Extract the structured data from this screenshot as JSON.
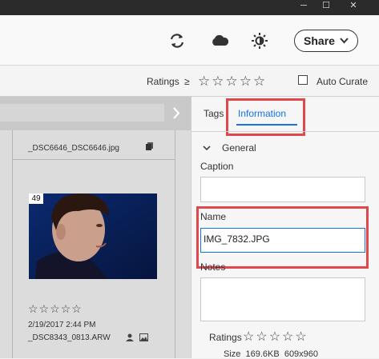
{
  "titlebar": {
    "minimize": "─",
    "maximize": "☐",
    "close": "✕"
  },
  "toolbar": {
    "share_label": "Share"
  },
  "filter": {
    "ratings_label": "Ratings",
    "operator": "≥",
    "auto_curate_label": "Auto Curate",
    "auto_curate_checked": false
  },
  "grid": {
    "items": [
      {
        "filename": "_DSC6646_DSC6646.jpg"
      },
      {
        "index": "49",
        "date": "2/19/2017 2:44 PM",
        "filename": "_DSC8343_0813.ARW"
      }
    ]
  },
  "panel": {
    "tabs": [
      {
        "label": "Tags"
      },
      {
        "label": "Information"
      }
    ],
    "active_tab": "Information",
    "section_title": "General",
    "caption_label": "Caption",
    "caption_value": "",
    "name_label": "Name",
    "name_value": "IMG_7832.JPG",
    "notes_label": "Notes",
    "notes_value": "",
    "ratings_label": "Ratings",
    "size_line": "Size  169.6KB  609x960"
  },
  "colors": {
    "highlight": "#e0474c",
    "accent": "#1473e6"
  }
}
